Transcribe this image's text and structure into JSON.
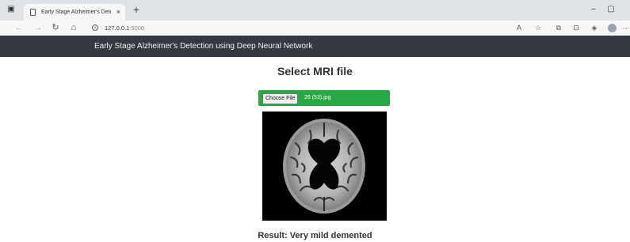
{
  "browser": {
    "tab_title": "Early Stage Alzheimer's Detectio",
    "tab_close": "×",
    "new_tab": "+",
    "url_host": "127.0.0.1",
    "url_port": ":5000",
    "window_minimize": "–",
    "window_restore": "▢",
    "more_menu": "···"
  },
  "navbar": {
    "brand": "Early Stage Alzheimer's Detection using Deep Neural Network"
  },
  "main": {
    "heading": "Select MRI file",
    "choose_file_label": "Choose File",
    "selected_file": "26 (53).jpg",
    "result_text": "Result: Very mild demented"
  },
  "colors": {
    "navbar_bg": "#343a40",
    "upload_bar": "#28a745"
  }
}
